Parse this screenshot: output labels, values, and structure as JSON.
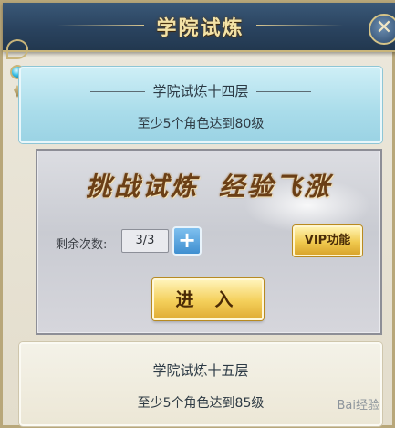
{
  "header": {
    "title": "学院试炼",
    "close_symbol": "✕"
  },
  "current_level": {
    "title": "学院试炼十四层",
    "requirement": "至少5个角色达到80级"
  },
  "challenge": {
    "slogan_left": "挑战试炼",
    "slogan_right": "经验飞涨",
    "remaining_label": "剩余次数:",
    "remaining_value": "3/3",
    "plus_symbol": "+",
    "vip_label": "VIP功能",
    "enter_label": "进 入"
  },
  "next_level": {
    "title": "学院试炼十五层",
    "requirement": "至少5个角色达到85级"
  },
  "watermark": "Bai经验",
  "colors": {
    "header_bg": "#2a435f",
    "title_gold": "#f3e2a6",
    "current_card": "#a9dcea",
    "button_gold": "#f0c94e",
    "plus_blue": "#3f8fd0"
  },
  "icons": [
    "close-icon",
    "plus-icon",
    "gem-pendant-icon"
  ]
}
